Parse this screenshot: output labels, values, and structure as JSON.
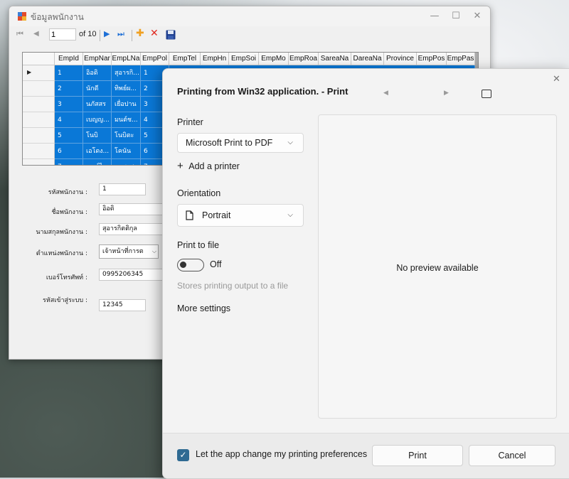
{
  "employee_window": {
    "title": "ข้อมูลพนักงาน",
    "caption_buttons": {
      "minimize": "—",
      "maximize": "☐",
      "close": "✕"
    },
    "navigator": {
      "position": "1",
      "count_text": "of 10",
      "first": "⏮",
      "prev": "◀",
      "next": "▶",
      "last": "⏭",
      "add": "✚",
      "delete": "✕",
      "save": "💾"
    },
    "grid": {
      "columns": [
        "EmpId",
        "EmpNar",
        "EmpLNa",
        "EmpPol",
        "EmpTel",
        "EmpHn",
        "EmpSoi",
        "EmpMo",
        "EmpRoa",
        "SareaNa",
        "DareaNa",
        "Province",
        "EmpPos",
        "EmpPas"
      ],
      "current_row_marker": "▶",
      "rows": [
        [
          "1",
          "อิอดิ",
          "สุอารกิ...",
          "1"
        ],
        [
          "2",
          "นักดี",
          "ทิพย์ผ...",
          "2"
        ],
        [
          "3",
          "นภัสสร",
          "เยื่อปาน",
          "3"
        ],
        [
          "4",
          "เบญญ...",
          "มนต์ช...",
          "4"
        ],
        [
          "5",
          "โนบิ",
          "โนบิตะ",
          "5"
        ],
        [
          "6",
          "เอโดง...",
          "โคนัน",
          "6"
        ],
        [
          "7",
          "เจอร์ไอ...",
          "นรพงศ...",
          "7"
        ]
      ]
    },
    "form": {
      "emp_id_label": "รหัสพนักงาน :",
      "emp_id_value": "1",
      "emp_name_label": "ชื่อพนักงาน :",
      "emp_name_value": "อิอดิ",
      "emp_lname_label": "นามสกุลพนักงาน :",
      "emp_lname_value": "สุอารกิตติกุล",
      "position_label": "ตำแหน่งพนักงาน :",
      "position_value": "เจ้าหน้าที่การต",
      "phone_label": "เบอร์โทรศัพท์ :",
      "phone_value": "0995206345",
      "password_label": "รหัสเข้าสู่ระบบ :",
      "password_value": "12345"
    }
  },
  "print_dialog": {
    "title": "Printing from Win32 application. - Print",
    "close_icon": "✕",
    "prev_page": "◀",
    "next_page": "▶",
    "printer_label": "Printer",
    "printer_value": "Microsoft Print to PDF",
    "add_printer": "Add a printer",
    "add_icon": "+",
    "orientation_label": "Orientation",
    "orientation_value": "Portrait",
    "print_to_file_label": "Print to file",
    "print_to_file_state": "Off",
    "print_to_file_hint": "Stores printing output to a file",
    "more_settings": "More settings",
    "preview_text": "No preview available",
    "checkbox_label": "Let the app change my printing preferences",
    "checkbox_mark": "✓",
    "print_button": "Print",
    "cancel_button": "Cancel"
  },
  "colors": {
    "grid_selection": "#0a78d7",
    "toggle_accent": "#333333",
    "checkbox_accent": "#2f6a92"
  }
}
